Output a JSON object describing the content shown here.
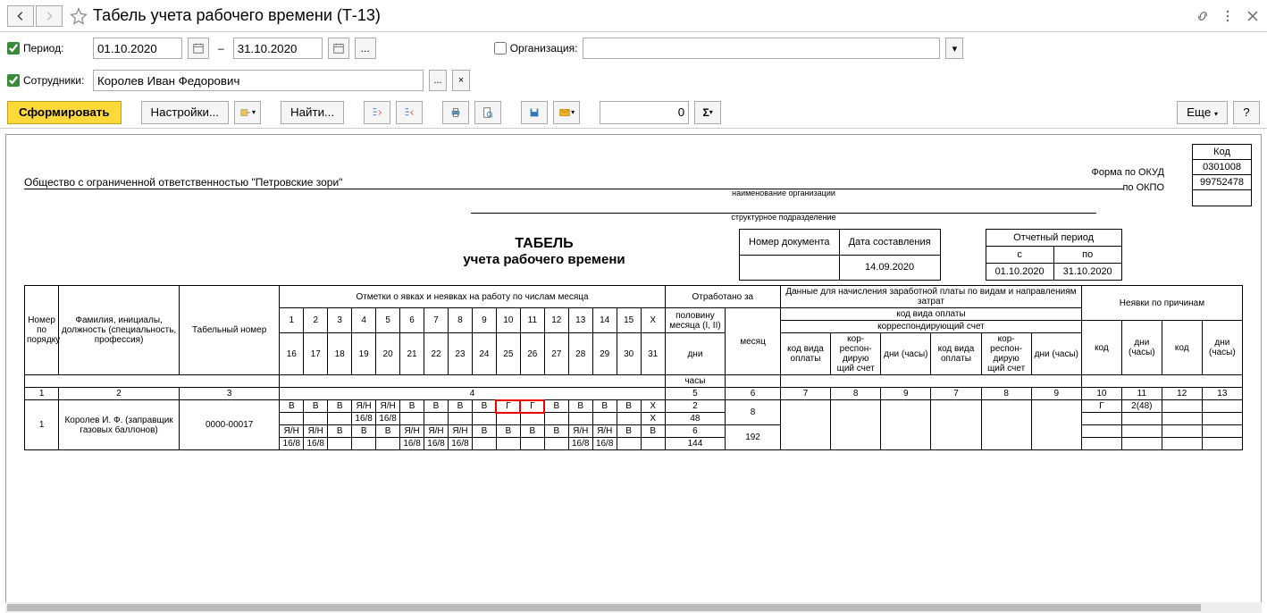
{
  "titlebar": {
    "title": "Табель учета рабочего времени (Т-13)"
  },
  "filters": {
    "period_label": "Период:",
    "date_from": "01.10.2020",
    "date_to": "31.10.2020",
    "org_label": "Организация:",
    "org_value": "",
    "emp_label": "Сотрудники:",
    "emp_value": "Королев Иван Федорович"
  },
  "toolbar": {
    "generate": "Сформировать",
    "settings": "Настройки...",
    "find": "Найти...",
    "num_value": "0",
    "more": "Еще",
    "help": "?"
  },
  "report": {
    "code_header": "Код",
    "okud_label": "Форма по ОКУД",
    "okud": "0301008",
    "okpo_label": "по ОКПО",
    "okpo": "99752478",
    "org_name": "Общество с ограниченной ответственностью \"Петровские зори\"",
    "org_caption": "наименование организации",
    "dept_caption": "структурное подразделение",
    "docnum_h": "Номер документа",
    "docdate_h": "Дата составления",
    "docnum": "",
    "docdate": "14.09.2020",
    "period_h": "Отчетный период",
    "period_from_h": "с",
    "period_to_h": "по",
    "period_from": "01.10.2020",
    "period_to": "31.10.2020",
    "title": "ТАБЕЛЬ",
    "subtitle": "учета  рабочего времени"
  },
  "headers": {
    "c1": "Номер по порядку",
    "c2": "Фамилия, инициалы, должность (специальность, профессия)",
    "c3": "Табельный номер",
    "c4": "Отметки о явках и неявках на работу по числам месяца",
    "c5": "Отработано за",
    "c5a": "половину месяца (I, II)",
    "c5b": "месяц",
    "c5c": "дни",
    "c5d": "часы",
    "c6": "Данные для начисления заработной платы по видам и направлениям затрат",
    "c6a": "код вида оплаты",
    "c6b": "корреспондирующий счет",
    "c6c": "код вида оплаты",
    "c6d": "кор-респон-дирую щий счет",
    "c6e": "дни (часы)",
    "c7": "Неявки по причинам",
    "c7a": "код",
    "c7b": "дни (часы)",
    "d": [
      "1",
      "2",
      "3",
      "4",
      "5",
      "6",
      "7",
      "8",
      "9",
      "10",
      "11",
      "12",
      "13",
      "14",
      "15",
      "X",
      "16",
      "17",
      "18",
      "19",
      "20",
      "21",
      "22",
      "23",
      "24",
      "25",
      "26",
      "27",
      "28",
      "29",
      "30",
      "31"
    ],
    "nums": [
      "1",
      "2",
      "3",
      "4",
      "5",
      "6",
      "7",
      "8",
      "9",
      "10",
      "11",
      "12",
      "13"
    ]
  },
  "row1": {
    "num": "1",
    "name": "Королев И. Ф. (заправщик газовых баллонов)",
    "tabnum": "0000-00017",
    "marks1": [
      "В",
      "В",
      "В",
      "Я/Н",
      "Я/Н",
      "В",
      "В",
      "В",
      "В",
      "Г",
      "Г",
      "В",
      "В",
      "В",
      "В",
      "X"
    ],
    "hours1": [
      "",
      "",
      "",
      "16/8",
      "16/8",
      "",
      "",
      "",
      "",
      "",
      "",
      "",
      "",
      "",
      "",
      "X"
    ],
    "marks2": [
      "Я/Н",
      "Я/Н",
      "В",
      "В",
      "В",
      "Я/Н",
      "Я/Н",
      "Я/Н",
      "В",
      "В",
      "В",
      "В",
      "Я/Н",
      "Я/Н",
      "В",
      "В"
    ],
    "hours2": [
      "16/8",
      "16/8",
      "",
      "",
      "",
      "16/8",
      "16/8",
      "16/8",
      "",
      "",
      "",
      "",
      "16/8",
      "16/8",
      "",
      ""
    ],
    "half_days1": "2",
    "half_hours1": "48",
    "half_days2": "6",
    "half_hours2": "144",
    "month_days": "8",
    "month_hours": "192",
    "abs_code": "Г",
    "abs_days": "2(48)"
  }
}
